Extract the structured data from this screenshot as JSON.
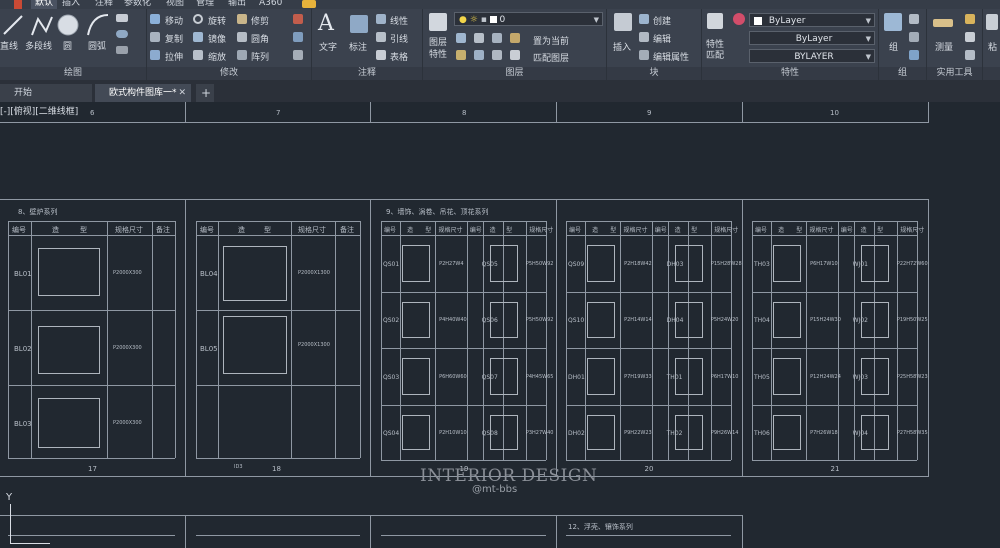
{
  "menubar": {
    "items": [
      "默认",
      "插入",
      "注释",
      "参数化",
      "视图",
      "管理",
      "输出",
      "A360"
    ]
  },
  "ribbon": {
    "draw": {
      "title": "绘图",
      "line": "直线",
      "polyline": "多段线",
      "circle": "圆",
      "arc": "圆弧"
    },
    "modify": {
      "title": "修改",
      "move": "移动",
      "rotate": "旋转",
      "trim": "修剪",
      "copy": "复制",
      "mirror": "镜像",
      "fillet": "圆角",
      "stretch": "拉伸",
      "scale": "缩放",
      "array": "阵列"
    },
    "annotation": {
      "title": "注释",
      "text": "文字",
      "dimension": "标注",
      "linear": "线性",
      "leader": "引线",
      "table": "表格"
    },
    "layers": {
      "title": "图层",
      "properties": "图层\n特性",
      "layer_value": "0",
      "set_current": "置为当前",
      "match_layer": "匹配图层"
    },
    "block": {
      "title": "块",
      "insert": "插入",
      "create": "创建",
      "edit": "编辑",
      "edit_attr": "编辑属性"
    },
    "properties": {
      "title": "特性",
      "match": "特性\n匹配",
      "color": "ByLayer",
      "linetype": "ByLayer",
      "lineweight": "BYLAYER"
    },
    "groups": {
      "title": "组",
      "group": "组"
    },
    "utilities": {
      "title": "实用工具",
      "measure": "测量"
    },
    "clipboard": {
      "paste": "粘"
    }
  },
  "tabs": [
    {
      "label": "开始"
    },
    {
      "label": "欧式构件图库一*"
    }
  ],
  "viewport": {
    "label": "[-][俯视][二维线框]"
  },
  "top_columns": [
    "6",
    "7",
    "8",
    "9",
    "10"
  ],
  "sheets": [
    {
      "title": "8、壁炉系列",
      "headers": [
        "编号",
        "造",
        "型",
        "规格尺寸",
        "备注"
      ],
      "rows": [
        {
          "code": "BL01",
          "spec": "P2000X300"
        },
        {
          "code": "BL02",
          "spec": "P2000X300"
        },
        {
          "code": "BL03",
          "spec": "P2000X300"
        }
      ],
      "page": "17"
    },
    {
      "title": "",
      "headers": [
        "编号",
        "造",
        "型",
        "规格尺寸",
        "备注"
      ],
      "rows": [
        {
          "code": "BL04",
          "spec": "P2000X1300"
        },
        {
          "code": "BL05",
          "spec": "P2000X1300"
        }
      ],
      "page": "18",
      "note": "ID3"
    },
    {
      "title": "9、墙饰、涡卷、吊花、顶花系列",
      "headers": [
        "编号",
        "造",
        "型",
        "规格尺寸",
        "编号",
        "造",
        "型",
        "规格尺寸"
      ],
      "rows": [
        {
          "code": "QS01",
          "spec": "P2H27W4",
          "code2": "QS05",
          "spec2": "P5H50W92"
        },
        {
          "code": "QS02",
          "spec": "P4H40W40",
          "code2": "QS06",
          "spec2": "P5H50W92"
        },
        {
          "code": "QS03",
          "spec": "P6H60W60",
          "code2": "QS07",
          "spec2": "P4H45W65"
        },
        {
          "code": "QS04",
          "spec": "P2H10W10",
          "code2": "QS08",
          "spec2": "P3H27W40"
        }
      ],
      "page": "19"
    },
    {
      "title": "",
      "headers": [
        "编号",
        "造",
        "型",
        "规格尺寸",
        "编号",
        "造",
        "型",
        "规格尺寸"
      ],
      "rows": [
        {
          "code": "QS09",
          "spec": "P2H18W42",
          "code2": "DH03",
          "spec2": "P15H28W28"
        },
        {
          "code": "QS10",
          "spec": "P2H14W14",
          "code2": "DH04",
          "spec2": "P5H24W20"
        },
        {
          "code": "DH01",
          "spec": "P7H19W33",
          "code2": "TH01",
          "spec2": "P6H17W10"
        },
        {
          "code": "DH02",
          "spec": "P9H22W23",
          "code2": "TH02",
          "spec2": "P9H26W14"
        }
      ],
      "page": "20"
    },
    {
      "title": "",
      "headers": [
        "编号",
        "造",
        "型",
        "规格尺寸",
        "编号",
        "造",
        "型",
        "规格尺寸"
      ],
      "rows": [
        {
          "code": "TH03",
          "spec": "P6H17W10",
          "code2": "WJ01",
          "spec2": "P22H72W60"
        },
        {
          "code": "TH04",
          "spec": "P15H24W30",
          "code2": "WJ02",
          "spec2": "P19H50W25"
        },
        {
          "code": "TH05",
          "spec": "P12H24W24",
          "code2": "WJ03",
          "spec2": "P25H58W23"
        },
        {
          "code": "TH06",
          "spec": "P7H26W18",
          "code2": "WJ04",
          "spec2": "P27H58W35"
        }
      ],
      "page": "21"
    }
  ],
  "bottom_title": "12、浮壳、镶饰系列",
  "watermark": {
    "line1": "INTERIOR DESIGN",
    "line2": "@mt-bbs"
  },
  "ucs": {
    "y_label": "Y"
  },
  "colors": {
    "canvas": "#212830",
    "ribbon": "#3b424e",
    "lines": "#8f98a3"
  }
}
